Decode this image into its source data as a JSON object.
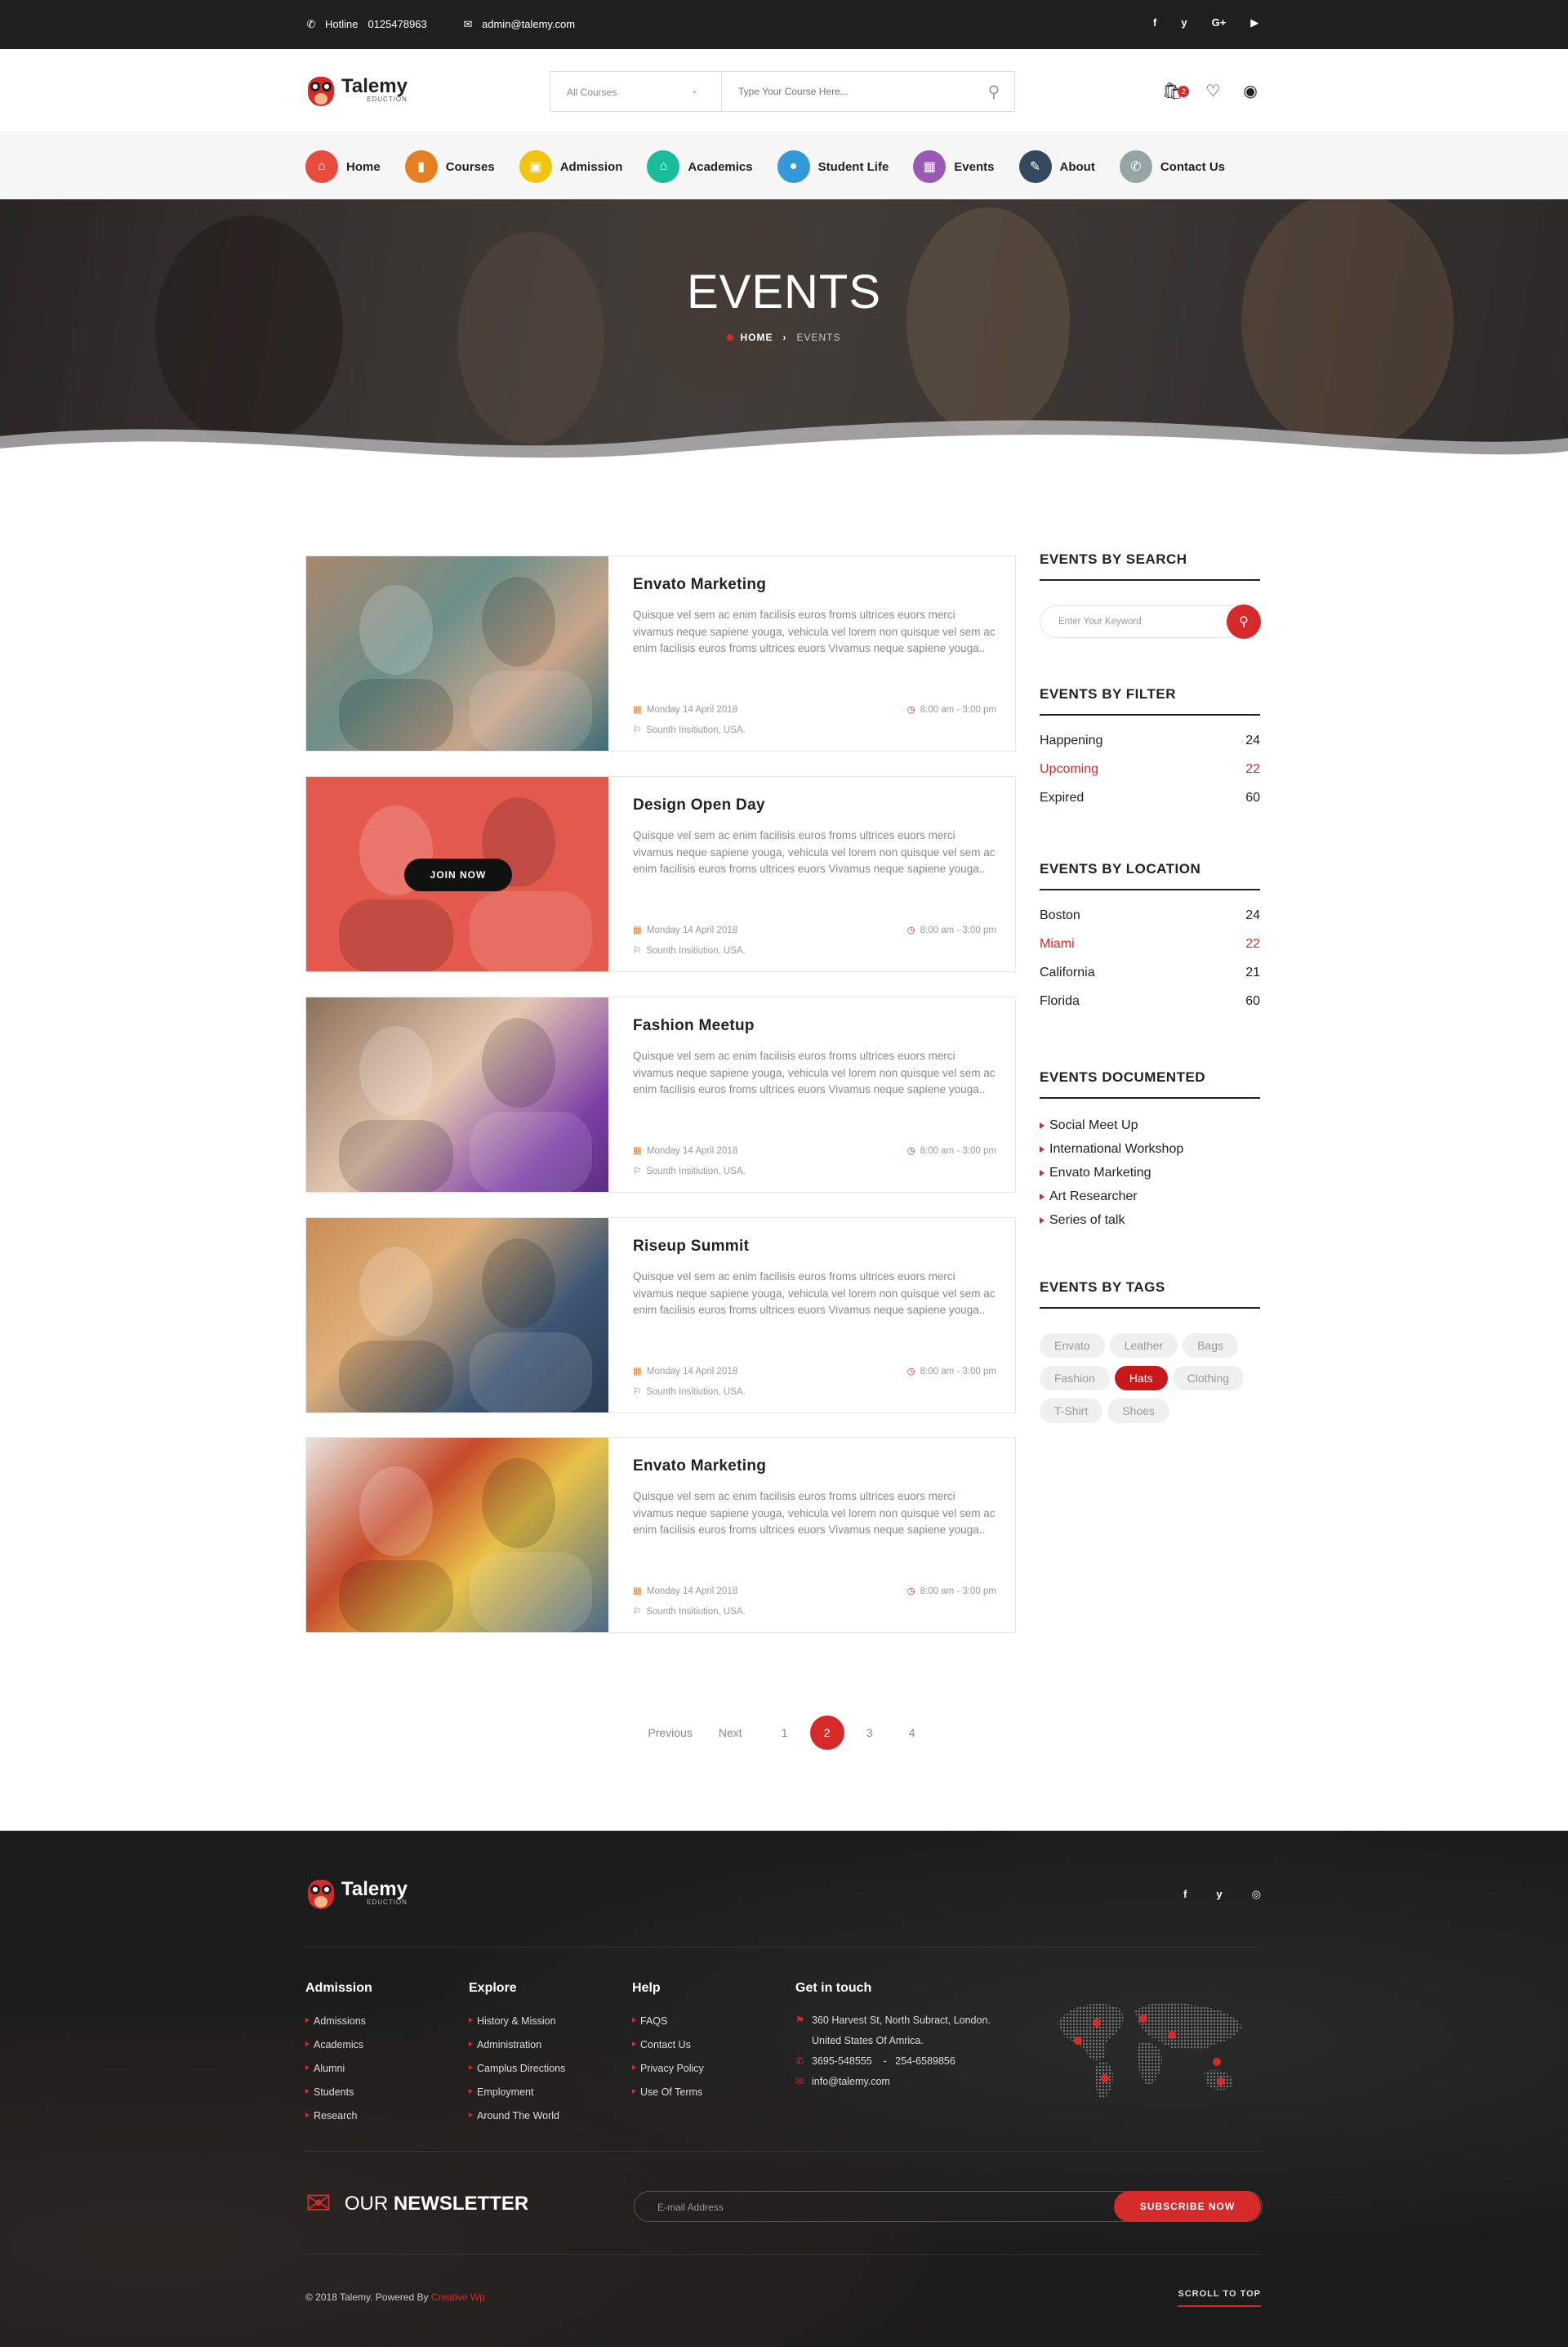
{
  "topbar": {
    "hotline_label": "Hotline",
    "hotline_number": "0125478963",
    "email": "admin@talemy.com",
    "social": [
      "f",
      "y",
      "G+",
      "▶"
    ]
  },
  "header": {
    "brand": "Talemy",
    "brand_sub": "EDUCTION",
    "category_select": "All Courses",
    "search_placeholder": "Type Your Course Here...",
    "cart_count": "2"
  },
  "nav": [
    {
      "label": "Home",
      "color": "#e74c3c",
      "icon": "home-icon",
      "glyph": "⌂"
    },
    {
      "label": "Courses",
      "color": "#e67e22",
      "icon": "book-icon",
      "glyph": "▮"
    },
    {
      "label": "Admission",
      "color": "#f1c40f",
      "icon": "document-icon",
      "glyph": "▣"
    },
    {
      "label": "Academics",
      "color": "#1abc9c",
      "icon": "building-icon",
      "glyph": "⌂"
    },
    {
      "label": "Student Life",
      "color": "#3498db",
      "icon": "user-icon",
      "glyph": "●"
    },
    {
      "label": "Events",
      "color": "#9b59b6",
      "icon": "calendar-icon",
      "glyph": "▦"
    },
    {
      "label": "About",
      "color": "#34495e",
      "icon": "pen-icon",
      "glyph": "✎"
    },
    {
      "label": "Contact Us",
      "color": "#95a5a6",
      "icon": "phone-icon",
      "glyph": "✆"
    }
  ],
  "banner": {
    "title": "EVENTS",
    "crumb_home": "HOME",
    "crumb_current": "EVENTS"
  },
  "events": [
    {
      "title": "Envato Marketing",
      "desc": "Quisque vel sem ac enim facilisis euros froms ultrices euors merci vivamus neque sapiene youga, vehicula vel lorem non quisque vel sem ac enim facilisis euros froms ultrices euors Vivamus neque sapiene youga..",
      "date": "Monday 14 April 2018",
      "time": "8:00 am - 3:00 pm",
      "location": "Sounth Insitiution, USA."
    },
    {
      "title": "Design Open Day",
      "desc": "Quisque vel sem ac enim facilisis euros froms ultrices euors merci vivamus neque sapiene youga, vehicula vel lorem non quisque vel sem ac enim facilisis euros froms ultrices euors Vivamus neque sapiene youga..",
      "date": "Monday 14 April 2018",
      "time": "8:00 am - 3:00 pm",
      "location": "Sounth Insitiution, USA.",
      "join": "JOIN NOW"
    },
    {
      "title": "Fashion Meetup",
      "desc": "Quisque vel sem ac enim facilisis euros froms ultrices euors merci vivamus neque sapiene youga, vehicula vel lorem non quisque vel sem ac enim facilisis euros froms ultrices euors Vivamus neque sapiene youga..",
      "date": "Monday 14 April 2018",
      "time": "8:00 am - 3:00 pm",
      "location": "Sounth Insitiution, USA."
    },
    {
      "title": "Riseup Summit",
      "desc": "Quisque vel sem ac enim facilisis euros froms ultrices euors merci vivamus neque sapiene youga, vehicula vel lorem non quisque vel sem ac enim facilisis euros froms ultrices euors Vivamus neque sapiene youga..",
      "date": "Monday 14 April 2018",
      "time": "8:00 am - 3:00 pm",
      "location": "Sounth Insitiution, USA."
    },
    {
      "title": "Envato Marketing",
      "desc": "Quisque vel sem ac enim facilisis euros froms ultrices euors merci vivamus neque sapiene youga, vehicula vel lorem non quisque vel sem ac enim facilisis euros froms ultrices euors Vivamus neque sapiene youga..",
      "date": "Monday 14 April 2018",
      "time": "8:00 am - 3:00 pm",
      "location": "Sounth Insitiution, USA."
    }
  ],
  "sidebar": {
    "search_title": "EVENTS BY SEARCH",
    "search_placeholder": "Enter Your Keyword",
    "filter_title": "EVENTS BY FILTER",
    "filters": [
      {
        "label": "Happening",
        "count": "24"
      },
      {
        "label": "Upcoming",
        "count": "22",
        "active": true
      },
      {
        "label": "Expired",
        "count": "60"
      }
    ],
    "location_title": "EVENTS BY LOCATION",
    "locations": [
      {
        "label": "Boston",
        "count": "24"
      },
      {
        "label": "Miami",
        "count": "22",
        "active": true
      },
      {
        "label": "California",
        "count": "21"
      },
      {
        "label": "Florida",
        "count": "60"
      }
    ],
    "documented_title": "EVENTS DOCUMENTED",
    "documented": [
      "Social Meet Up",
      "International Workshop",
      "Envato Marketing",
      "Art Researcher",
      "Series of talk"
    ],
    "tags_title": "EVENTS BY TAGS",
    "tags": [
      {
        "label": "Envato"
      },
      {
        "label": "Leather"
      },
      {
        "label": "Bags"
      },
      {
        "label": "Fashion"
      },
      {
        "label": "Hats",
        "active": true
      },
      {
        "label": "Clothing"
      },
      {
        "label": "T-Shirt"
      },
      {
        "label": "Shoes"
      }
    ]
  },
  "pagination": {
    "previous": "Previous",
    "next": "Next",
    "pages": [
      "1",
      "2",
      "3",
      "4"
    ],
    "current": "2"
  },
  "footer": {
    "brand": "Talemy",
    "brand_sub": "EDUCTION",
    "social": [
      "f",
      "y",
      "◎"
    ],
    "columns": [
      {
        "title": "Admission",
        "items": [
          "Admissions",
          "Academics",
          "Alumni",
          "Students",
          "Research"
        ]
      },
      {
        "title": "Explore",
        "items": [
          "History & Mission",
          "Administration",
          "Camplus Directions",
          "Employment",
          "Around The World"
        ]
      },
      {
        "title": "Help",
        "items": [
          "FAQS",
          "Contact Us",
          "Privacy Policy",
          "Use Of Terms"
        ]
      }
    ],
    "contact_title": "Get in touch",
    "address_1": "360 Harvest St, North Subract, London.",
    "address_2": "United States Of Amrica.",
    "phone": "3695-548555    -   254-6589856",
    "email": "info@talemy.com",
    "newsletter_prefix": "OUR",
    "newsletter_bold": "NEWSLETTER",
    "newsletter_placeholder": "E-mail Address",
    "subscribe": "SUBSCRIBE NOW",
    "copyright": "© 2018 Talemy.  Powered By",
    "copyright_link": "Creative Wp",
    "scroll_top": "SCROLL TO TOP"
  }
}
